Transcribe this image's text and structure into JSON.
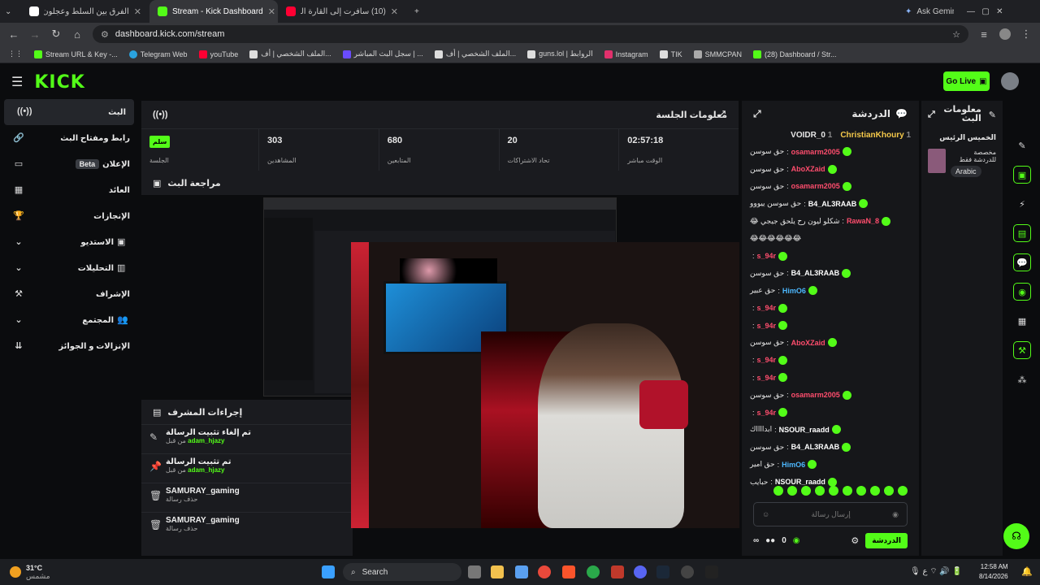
{
  "browser": {
    "tabs": [
      {
        "title": "الفرق بين السلط وعجلون - بحث",
        "color": "#4285f4",
        "active": false
      },
      {
        "title": "Stream - Kick Dashboard",
        "color": "#53fc18",
        "active": true
      },
      {
        "title": "(10) سافرت إلى القارة القطبية ال...",
        "color": "#ff0033",
        "active": false
      }
    ],
    "ask_gemini": "Ask Gemini",
    "url": "dashboard.kick.com/stream",
    "bookmarks": [
      {
        "label": "Stream URL & Key -...",
        "color": "#53fc18"
      },
      {
        "label": "Telegram Web",
        "color": "#2aa3df"
      },
      {
        "label": "youTube",
        "color": "#ff0033"
      },
      {
        "label": "الملف الشخصي | أف...",
        "color": "#ffffff"
      },
      {
        "label": "سجل البث المباشر | ...",
        "color": "#6a4cff"
      },
      {
        "label": "الملف الشخصي | أف...",
        "color": "#ffffff"
      },
      {
        "label": "guns.lol | الروابط",
        "color": "#ffffff"
      },
      {
        "label": "Instagram",
        "color": "#e1306c"
      },
      {
        "label": "TIK",
        "color": "#ffffff"
      },
      {
        "label": "SMMCPAN",
        "color": "#aaaaaa"
      },
      {
        "label": "(28) Dashboard / Str...",
        "color": "#53fc18"
      }
    ]
  },
  "header": {
    "logo": "KICK",
    "go_live": "Go Live"
  },
  "sidebar": {
    "items": [
      {
        "label": "البث",
        "icon": "broadcast-icon",
        "active": true
      },
      {
        "label": "رابط ومفتاح البث",
        "icon": "link-icon"
      },
      {
        "label": "الإعلان",
        "icon": "ad-icon",
        "badge": "Beta"
      },
      {
        "label": "العائد",
        "icon": "revenue-icon"
      },
      {
        "label": "الإنجازات",
        "icon": "trophy-icon"
      },
      {
        "label": "الاستديو",
        "icon": "studio-icon",
        "chevron": true
      },
      {
        "label": "التحليلات",
        "icon": "analytics-icon",
        "chevron": true
      },
      {
        "label": "الإشراف",
        "icon": "moderation-icon"
      },
      {
        "label": "المجتمع",
        "icon": "community-icon",
        "chevron": true
      },
      {
        "label": "الإنزالات و الجوائز",
        "icon": "drops-icon"
      }
    ]
  },
  "session": {
    "title": "معلومات الجلسة",
    "end_button": "سلم",
    "session_label": "الجلسة",
    "stats": [
      {
        "value": "303",
        "label": "المشاهدين"
      },
      {
        "value": "680",
        "label": "المتابعين"
      },
      {
        "value": "20",
        "label": "تحاد الاشتراكات"
      },
      {
        "value": "02:57:18",
        "label": "الوقت مباشر"
      }
    ]
  },
  "preview": {
    "title": "مراجعة البث"
  },
  "moderation": {
    "title": "إجراءات المشرف",
    "actions": [
      {
        "title": "تم إلغاء تثبيت الرسالة",
        "by_prefix": "من قبل",
        "user": "adam_hjazy",
        "icon": "unpin-icon"
      },
      {
        "title": "تم تثبيت الرسالة",
        "by_prefix": "من قبل",
        "user": "adam_hjazy",
        "icon": "pin-icon"
      },
      {
        "title": "SAMURAY_gaming",
        "sub": "حذف رسالة",
        "icon": "trash-icon"
      },
      {
        "title": "SAMURAY_gaming",
        "sub": "حذف رسالة",
        "icon": "trash-icon"
      }
    ]
  },
  "chat": {
    "title": "الدردشة",
    "pinned": [
      {
        "name": "ChristianKhoury",
        "count": "1"
      },
      {
        "name": "VOIDR_0",
        "count": "1"
      }
    ],
    "messages": [
      {
        "user": "osamarm2005",
        "color": "#ff4d6d",
        "text": "حق سوسن"
      },
      {
        "user": "AboXZaid",
        "color": "#ff4d6d",
        "text": "حق سوسن"
      },
      {
        "user": "osamarm2005",
        "color": "#ff4d6d",
        "text": "حق سوسن"
      },
      {
        "user": "B4_AL3RAAB",
        "color": "#ffffff",
        "text": "حق سوسن ييووو"
      },
      {
        "user": "RawaN_8",
        "color": "#ff4d6d",
        "text": "شكلو ليون رح يلحق جيجي 😂"
      },
      {
        "user": "",
        "color": "#ffffff",
        "text": "😂😂😂😂😂😂"
      },
      {
        "user": "s_94r",
        "color": "#ff4d6d",
        "text": ""
      },
      {
        "user": "B4_AL3RAAB",
        "color": "#ffffff",
        "text": "حق سوسن"
      },
      {
        "user": "HimO6",
        "color": "#4db8ff",
        "text": "حق عبير"
      },
      {
        "user": "s_94r",
        "color": "#ff4d6d",
        "text": ""
      },
      {
        "user": "s_94r",
        "color": "#ff4d6d",
        "text": ""
      },
      {
        "user": "AboXZaid",
        "color": "#ff4d6d",
        "text": "حق سوسن"
      },
      {
        "user": "s_94r",
        "color": "#ff4d6d",
        "text": ""
      },
      {
        "user": "s_94r",
        "color": "#ff4d6d",
        "text": ""
      },
      {
        "user": "osamarm2005",
        "color": "#ff4d6d",
        "text": "حق سوسن"
      },
      {
        "user": "s_94r",
        "color": "#ff4d6d",
        "text": ""
      },
      {
        "user": "NSOUR_raadd",
        "color": "#ffffff",
        "text": "ابدااااك"
      },
      {
        "user": "B4_AL3RAAB",
        "color": "#ffffff",
        "text": "حق سوسن"
      },
      {
        "user": "HimO6",
        "color": "#4db8ff",
        "text": "حق امير"
      },
      {
        "user": "NSOUR_raadd",
        "color": "#ffffff",
        "text": "حبايب"
      }
    ],
    "input_placeholder": "إرسال رسالة",
    "viewers_count": "0",
    "send_label": "الدردشة"
  },
  "info": {
    "title": "معلومات البث",
    "stream_title": "الخميس الرئيس",
    "category": "مخصصة للدردشة فقط",
    "language": "Arabic"
  },
  "taskbar": {
    "temperature": "31°C",
    "weather": "مشمس",
    "search": "Search",
    "time": "12:58 AM",
    "date": "8/14/2026"
  }
}
